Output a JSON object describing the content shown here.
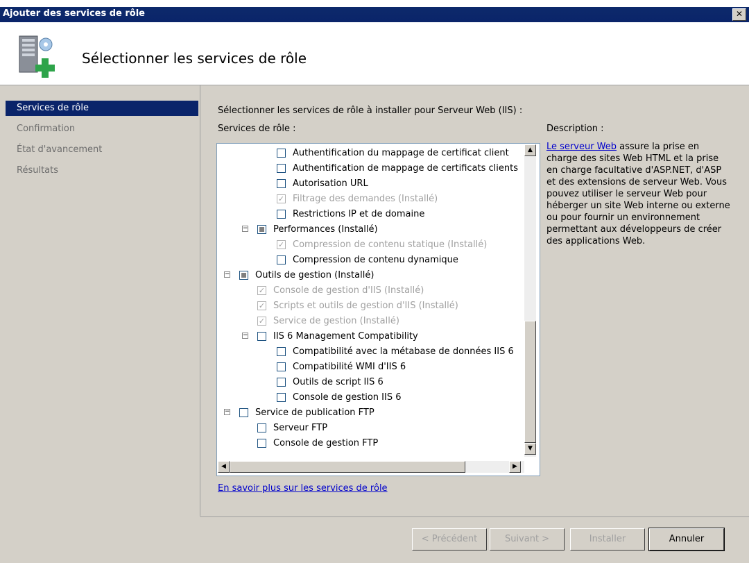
{
  "window": {
    "title": "Ajouter des services de rôle"
  },
  "header": {
    "heading": "Sélectionner les services de rôle",
    "icon": "server-add-icon"
  },
  "nav": [
    {
      "label": "Services de rôle",
      "active": true
    },
    {
      "label": "Confirmation",
      "active": false
    },
    {
      "label": "État d'avancement",
      "active": false
    },
    {
      "label": "Résultats",
      "active": false
    }
  ],
  "main": {
    "intro": "Sélectionner les services de rôle à installer pour Serveur Web (IIS) :",
    "services_label": "Services de rôle :",
    "description_label": "Description :",
    "description_link": "Le serveur Web",
    "description_text": " assure la prise en charge des sites Web HTML et la prise en charge facultative d'ASP.NET, d'ASP et des extensions de serveur Web. Vous pouvez utiliser le serveur Web pour héberger un site Web interne ou externe ou pour fournir un environnement permettant aux développeurs de créer des applications Web.",
    "learn_more": "En savoir plus sur les services de rôle"
  },
  "tree": [
    {
      "label": "Authentification du mappage de certificat client",
      "level": 3,
      "state": "unchecked"
    },
    {
      "label": "Authentification de mappage de certificats clients",
      "level": 3,
      "state": "unchecked"
    },
    {
      "label": "Autorisation URL",
      "level": 3,
      "state": "unchecked"
    },
    {
      "label": "Filtrage des demandes  (Installé)",
      "level": 3,
      "state": "installed"
    },
    {
      "label": "Restrictions IP et de domaine",
      "level": 3,
      "state": "unchecked"
    },
    {
      "label": "Performances  (Installé)",
      "level": 2,
      "state": "partial",
      "expander": "−"
    },
    {
      "label": "Compression de contenu statique  (Installé)",
      "level": 3,
      "state": "installed"
    },
    {
      "label": "Compression de contenu dynamique",
      "level": 3,
      "state": "unchecked"
    },
    {
      "label": "Outils de gestion  (Installé)",
      "level": 1,
      "state": "partial",
      "expander": "−"
    },
    {
      "label": "Console de gestion d'IIS  (Installé)",
      "level": 2,
      "state": "installed"
    },
    {
      "label": "Scripts et outils de gestion d'IIS  (Installé)",
      "level": 2,
      "state": "installed"
    },
    {
      "label": "Service de gestion  (Installé)",
      "level": 2,
      "state": "installed"
    },
    {
      "label": "IIS 6 Management Compatibility",
      "level": 2,
      "state": "unchecked",
      "expander": "−"
    },
    {
      "label": "Compatibilité avec la métabase de données IIS 6",
      "level": 3,
      "state": "unchecked"
    },
    {
      "label": "Compatibilité WMI d'IIS 6",
      "level": 3,
      "state": "unchecked"
    },
    {
      "label": "Outils de script IIS 6",
      "level": 3,
      "state": "unchecked"
    },
    {
      "label": "Console de gestion IIS 6",
      "level": 3,
      "state": "unchecked"
    },
    {
      "label": "Service de publication FTP",
      "level": 1,
      "state": "unchecked",
      "expander": "−"
    },
    {
      "label": "Serveur FTP",
      "level": 2,
      "state": "unchecked"
    },
    {
      "label": "Console de gestion FTP",
      "level": 2,
      "state": "unchecked"
    }
  ],
  "buttons": {
    "prev": "< Précédent",
    "next": "Suivant >",
    "install": "Installer",
    "cancel": "Annuler"
  }
}
